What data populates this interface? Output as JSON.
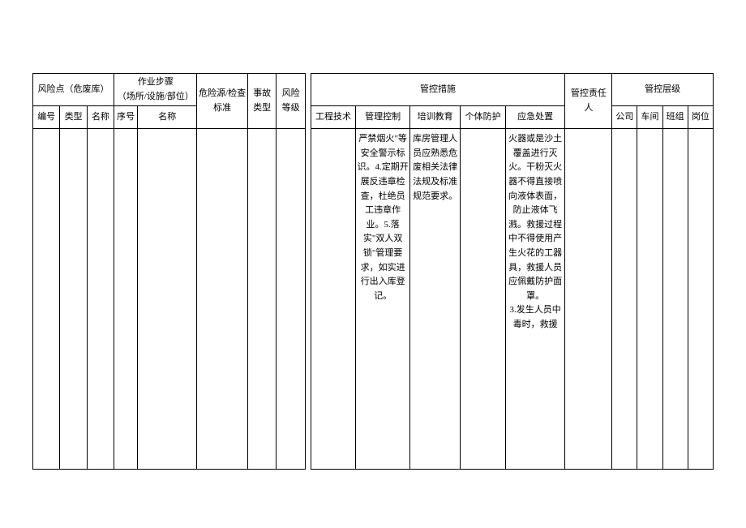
{
  "headers": {
    "risk_point": "风险点（危废库）",
    "work_step": "作业步骤\n（场所/设施/部位）",
    "hazard_std": "危险源/检查\n标准",
    "accident_type": "事故\n类型",
    "risk_level": "风险\n等级",
    "control_measures": "管控措施",
    "responsible": "管控责任人",
    "control_level": "管控层级",
    "sub": {
      "no": "编号",
      "type": "类型",
      "name": "名称",
      "seq": "序号",
      "step_name": "名称",
      "eng_tech": "工程技术",
      "mgmt_ctrl": "管理控制",
      "training": "培训教育",
      "personal_prot": "个体防护",
      "emergency": "应急处置",
      "company": "公司",
      "workshop": "车间",
      "team": "班组",
      "position": "岗位"
    }
  },
  "row": {
    "mgmt_ctrl": "严禁烟火\"等安全警示标识。4.定期开展反违章检查，杜绝员工违章作业。5.落实\"双人双锁\"管理要求，如实进行出入库登记。",
    "training": "库房管理人员应熟悉危废相关法律法规及标准规范要求。",
    "emergency": "火器或是沙土覆盖进行灭火。干粉灭火器不得直接喷向液体表面，防止液体飞溅。救援过程中不得使用产生火花的工器具，救援人员应佩戴防护面罩。\n3.发生人员中毒时，救援"
  }
}
